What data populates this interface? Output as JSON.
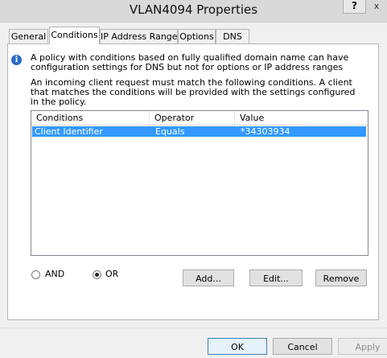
{
  "window": {
    "title": "VLAN4094 Properties",
    "help_label": "?",
    "close_label": "x"
  },
  "tabs": [
    {
      "label": "General"
    },
    {
      "label": "Conditions"
    },
    {
      "label": "IP Address Range"
    },
    {
      "label": "Options"
    },
    {
      "label": "DNS"
    }
  ],
  "info": {
    "icon": "info-icon",
    "icon_glyph": "i",
    "text": "A policy with conditions based on fully qualified domain name can have configuration settings for DNS but not for options or IP address ranges"
  },
  "description": "An incoming client request must match the following conditions. A client that matches the conditions will be provided with the settings configured in the policy.",
  "table": {
    "columns": [
      "Conditions",
      "Operator",
      "Value"
    ],
    "rows": [
      {
        "condition": "Client Identifier",
        "operator": "Equals",
        "value": "*34303934"
      }
    ]
  },
  "logic": {
    "and_label": "AND",
    "or_label": "OR",
    "selected": "OR"
  },
  "buttons": {
    "add": "Add...",
    "edit": "Edit...",
    "remove": "Remove",
    "ok": "OK",
    "cancel": "Cancel",
    "apply": "Apply"
  },
  "colors": {
    "selection": "#3399ff",
    "info_icon": "#2a6bc4"
  }
}
